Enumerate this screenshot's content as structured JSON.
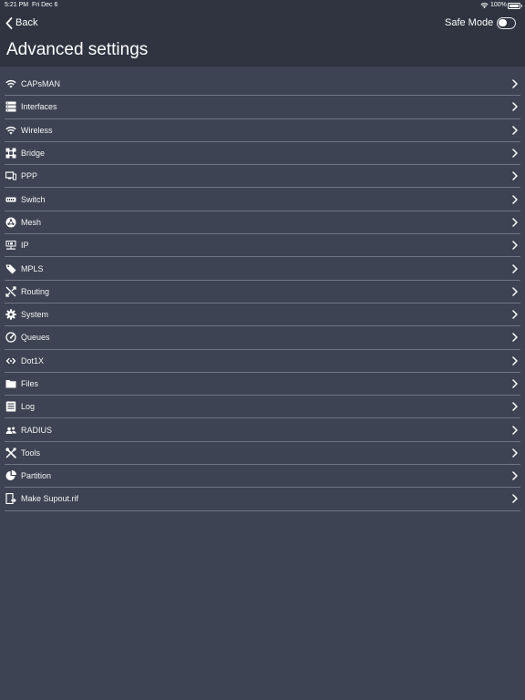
{
  "status_bar": {
    "time": "5:21 PM",
    "date": "Fri Dec 6",
    "battery": "100%",
    "wifi_icon": "wifi-icon",
    "battery_icon": "battery-icon"
  },
  "nav": {
    "back_label": "Back",
    "back_icon": "chevron-left-icon",
    "safe_mode_label": "Safe Mode",
    "safe_mode_on": false
  },
  "page": {
    "title": "Advanced settings"
  },
  "colors": {
    "header_bg": "#2f3440",
    "list_bg": "#3d4352",
    "divider": "#6e7482",
    "text": "#f2f3f5"
  },
  "menu": {
    "items": [
      {
        "label": "CAPsMAN",
        "icon": "wifi-icon"
      },
      {
        "label": "Interfaces",
        "icon": "interfaces-icon"
      },
      {
        "label": "Wireless",
        "icon": "wifi-icon"
      },
      {
        "label": "Bridge",
        "icon": "bridge-icon"
      },
      {
        "label": "PPP",
        "icon": "ppp-icon"
      },
      {
        "label": "Switch",
        "icon": "switch-icon"
      },
      {
        "label": "Mesh",
        "icon": "mesh-icon"
      },
      {
        "label": "IP",
        "icon": "ip-icon"
      },
      {
        "label": "MPLS",
        "icon": "tag-icon"
      },
      {
        "label": "Routing",
        "icon": "routing-icon"
      },
      {
        "label": "System",
        "icon": "gear-icon"
      },
      {
        "label": "Queues",
        "icon": "gauge-icon"
      },
      {
        "label": "Dot1X",
        "icon": "dot1x-icon"
      },
      {
        "label": "Files",
        "icon": "folder-icon"
      },
      {
        "label": "Log",
        "icon": "log-icon"
      },
      {
        "label": "RADIUS",
        "icon": "users-icon"
      },
      {
        "label": "Tools",
        "icon": "tools-icon"
      },
      {
        "label": "Partition",
        "icon": "pie-icon"
      },
      {
        "label": "Make Supout.rif",
        "icon": "supout-icon"
      }
    ]
  }
}
